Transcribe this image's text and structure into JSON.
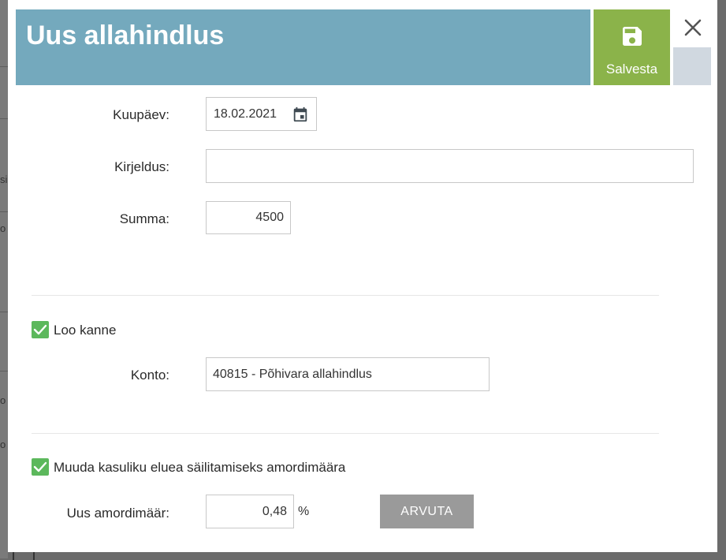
{
  "dialog": {
    "title": "Uus allahindlus",
    "save_label": "Salvesta"
  },
  "form": {
    "date_label": "Kuupäev:",
    "date_value": "18.02.2021",
    "description_label": "Kirjeldus:",
    "description_value": "",
    "sum_label": "Summa:",
    "sum_value": "4500",
    "create_entry_label": "Loo kanne",
    "create_entry_checked": true,
    "account_label": "Konto:",
    "account_value": "40815 - Põhivara allahindlus",
    "change_rate_label": "Muuda kasuliku eluea säilitamiseks amordimäära",
    "change_rate_checked": true,
    "new_rate_label": "Uus amordimäär:",
    "new_rate_value": "0,48",
    "percent_sign": "%",
    "calculate_label": "ARVUTA"
  },
  "background": {
    "fragments": [
      "si",
      "o",
      "o",
      "o"
    ]
  },
  "colors": {
    "header": "#74a9bd",
    "save": "#8bb34a",
    "checkbox": "#5cb85c",
    "calculate": "#9a9a9a"
  },
  "icons": {
    "save": "save-icon",
    "close": "close-icon",
    "calendar": "calendar-icon",
    "check": "check-icon"
  }
}
